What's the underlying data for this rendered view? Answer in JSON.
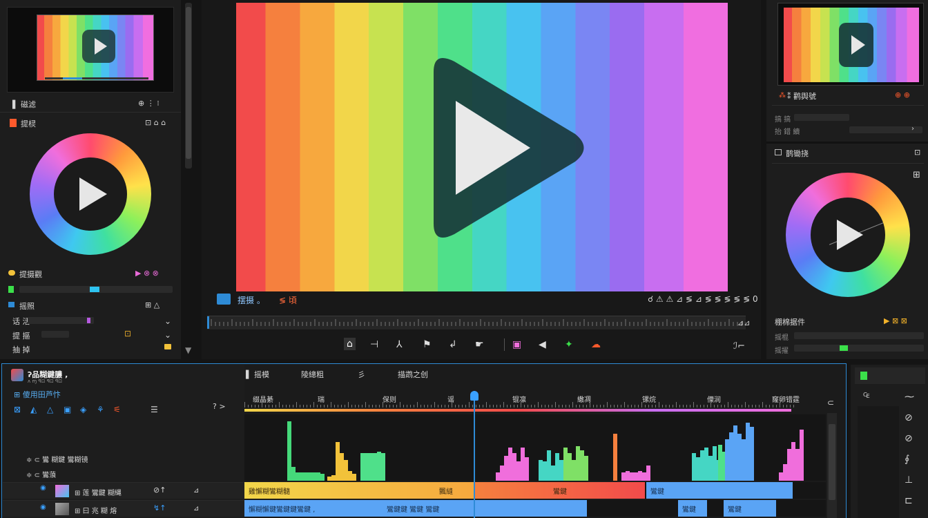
{
  "left_panel": {
    "preview_title": "▌ 磁滤",
    "preview_icons": "⊕ ⋮ ⁝",
    "color_title": "提棂",
    "color_icons": "⊡ ⌂ ⌂",
    "row1_label": "提摄觀",
    "row1_icons": "▶ ⊗ ⊗",
    "row2_label": "摇照",
    "row2_icons": "⊞ △",
    "row3_label": "话 活",
    "row4_label": "提 摳",
    "row5_label": "抽 掉",
    "level_value": 0.88
  },
  "viewer": {
    "label_left": "摆摄 。",
    "label_mid": "≶ 頃",
    "label_right": "☌ ⚠ ⚠ ⊿ ≶ ⊿ ≶ ≶ ≶ ≶ ≶ 0",
    "scrub_label": "⊿⊿",
    "toolbar_buttons": [
      "home-icon",
      "trim-icon",
      "ripple-icon",
      "razor-icon",
      "slip-icon",
      "hand-icon",
      "color-icon",
      "audio-icon",
      "effects-icon",
      "cloud-icon"
    ],
    "toolbar_glyphs": [
      "⌂",
      "⊣",
      "⅄",
      "⚑",
      "↲",
      "☛",
      "▣",
      "◀",
      "✦",
      "☁"
    ],
    "settings_glyph": "ℐ⌐"
  },
  "right_panel": {
    "header": "⁑ 鹳舆號",
    "header_icons": "⊕ ⊕",
    "row1": "搞 搞",
    "row2": "抬 錯 續",
    "section_title": "鹊锄挠",
    "section_icon": "⊡",
    "wheel_icon": "⊞",
    "footer_title": "棚棉据件",
    "footer_icons": "▶ ⊠ ⊠",
    "footer_row1": "摇棍",
    "footer_row2": "摇擢",
    "footer_level": 0.35
  },
  "timeline": {
    "app_name": "ʔ品糊鍵膿 ,",
    "app_sub": "ᴧ ɱ ꟼ⊡ ꟼ⊡ ꟼ⊡",
    "secondary": "⊞ 傻用田芦忭",
    "tabs": [
      "▌ 摇模",
      "陵總粗",
      "彡",
      "描鹉之创"
    ],
    "ruler_labels": [
      "缀晶綦",
      "瑞",
      "保则",
      "谣",
      "锟凛",
      "繖凋",
      "镙烷",
      "僳润",
      "窿卵错霆"
    ],
    "ruler_left": "? >",
    "tracks": [
      {
        "name": "≑ ⊂ 鸞 糊鍵 鸞糊镜",
        "icon": ""
      },
      {
        "name": "≑ ⊂ 鸞蒗",
        "icon": ""
      },
      {
        "name": "⊞ 莲 鸞鍵 糊縄",
        "icon": "⊘↑"
      },
      {
        "name": "⊞ 曰 兆 糊 熔",
        "icon": "↯↑"
      }
    ],
    "clip_labels_top": [
      "雞懈糊鸞糊髓",
      "飄縫",
      "鸞鍵",
      "鸞鍵"
    ],
    "clip_labels_bottom": [
      "懈糊懈鍵鸞鍵鍵鸞鍵 ,",
      "鸞鍵鍵 鸞鍵 鸞鍵",
      "鸞鍵",
      "鸞鍵"
    ],
    "playhead_value": 0.405
  },
  "far_right": {
    "tools": [
      "⁓",
      "⊘",
      "⊘",
      "∮",
      "⊥",
      "⊏"
    ],
    "status_glyph": "₠"
  },
  "colors": {
    "accent": "#2e8bd6",
    "green": "#3be04a",
    "orange": "#ff5a2c"
  }
}
